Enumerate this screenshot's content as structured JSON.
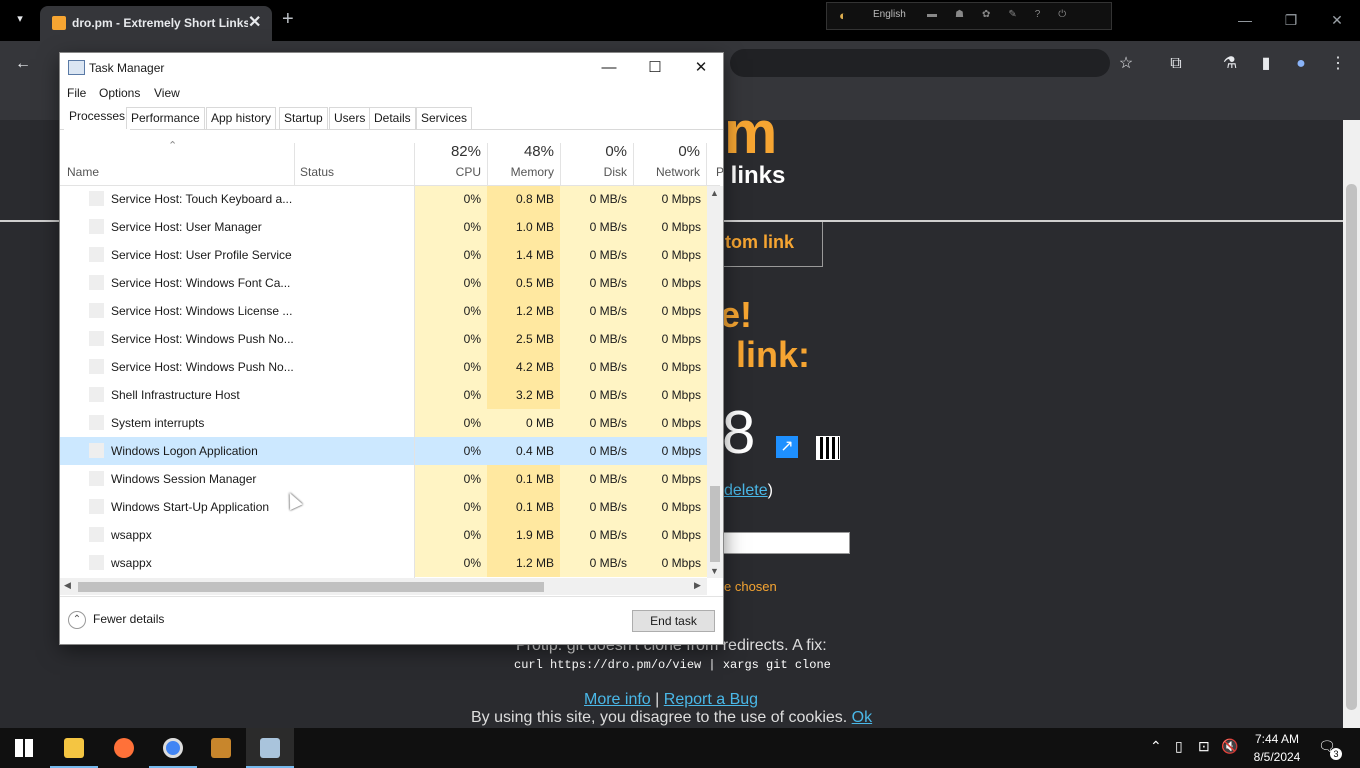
{
  "browser": {
    "tab_title": "dro.pm - Extremely Short Links",
    "lang": "English",
    "tab_close": "✕",
    "new_tab": "+"
  },
  "page": {
    "logo_partial": "m",
    "tagline_partial": "t links",
    "custom_btn_partial": "tom link",
    "heading1_partial": "e!",
    "heading2_partial": "link:",
    "short_code_partial": "8",
    "delete_link": "delete",
    "delete_close": ")",
    "chosen_partial": "e chosen",
    "protip": "Protip: git doesn't clone from redirects. A fix:",
    "protip_code": "curl https://dro.pm/o/view | xargs git clone",
    "more_info": "More info",
    "sep": "|",
    "report_bug": "Report a Bug",
    "cookie_text": "By using this site, you disagree to the use of cookies.",
    "cookie_ok": "Ok"
  },
  "task_manager": {
    "title": "Task Manager",
    "menu": [
      "File",
      "Options",
      "View"
    ],
    "tabs": [
      "Processes",
      "Performance",
      "App history",
      "Startup",
      "Users",
      "Details",
      "Services"
    ],
    "columns": {
      "name": "Name",
      "status": "Status",
      "cpu_pct": "82%",
      "cpu": "CPU",
      "mem_pct": "48%",
      "mem": "Memory",
      "disk_pct": "0%",
      "disk": "Disk",
      "net_pct": "0%",
      "net": "Network",
      "p": "P"
    },
    "rows": [
      {
        "name": "Service Host: Touch Keyboard a...",
        "cpu": "0%",
        "mem": "0.8 MB",
        "disk": "0 MB/s",
        "net": "0 Mbps"
      },
      {
        "name": "Service Host: User Manager",
        "cpu": "0%",
        "mem": "1.0 MB",
        "disk": "0 MB/s",
        "net": "0 Mbps"
      },
      {
        "name": "Service Host: User Profile Service",
        "cpu": "0%",
        "mem": "1.4 MB",
        "disk": "0 MB/s",
        "net": "0 Mbps"
      },
      {
        "name": "Service Host: Windows Font Ca...",
        "cpu": "0%",
        "mem": "0.5 MB",
        "disk": "0 MB/s",
        "net": "0 Mbps"
      },
      {
        "name": "Service Host: Windows License ...",
        "cpu": "0%",
        "mem": "1.2 MB",
        "disk": "0 MB/s",
        "net": "0 Mbps"
      },
      {
        "name": "Service Host: Windows Push No...",
        "cpu": "0%",
        "mem": "2.5 MB",
        "disk": "0 MB/s",
        "net": "0 Mbps"
      },
      {
        "name": "Service Host: Windows Push No...",
        "cpu": "0%",
        "mem": "4.2 MB",
        "disk": "0 MB/s",
        "net": "0 Mbps"
      },
      {
        "name": "Shell Infrastructure Host",
        "cpu": "0%",
        "mem": "3.2 MB",
        "disk": "0 MB/s",
        "net": "0 Mbps"
      },
      {
        "name": "System interrupts",
        "cpu": "0%",
        "mem": "0 MB",
        "disk": "0 MB/s",
        "net": "0 Mbps"
      },
      {
        "name": "Windows Logon Application",
        "cpu": "0%",
        "mem": "0.4 MB",
        "disk": "0 MB/s",
        "net": "0 Mbps"
      },
      {
        "name": "Windows Session Manager",
        "cpu": "0%",
        "mem": "0.1 MB",
        "disk": "0 MB/s",
        "net": "0 Mbps"
      },
      {
        "name": "Windows Start-Up Application",
        "cpu": "0%",
        "mem": "0.1 MB",
        "disk": "0 MB/s",
        "net": "0 Mbps"
      },
      {
        "name": "wsappx",
        "cpu": "0%",
        "mem": "1.9 MB",
        "disk": "0 MB/s",
        "net": "0 Mbps"
      },
      {
        "name": "wsappx",
        "cpu": "0%",
        "mem": "1.2 MB",
        "disk": "0 MB/s",
        "net": "0 Mbps"
      }
    ],
    "selected_row": "Windows Logon Application",
    "fewer_details": "Fewer details",
    "end_task": "End task"
  },
  "taskbar": {
    "time": "7:44 AM",
    "date": "8/5/2024",
    "notifications": "3"
  },
  "colors": {
    "accent": "#f6a532",
    "link": "#4ab8e8",
    "heat_light": "#fff4c4",
    "heat_mid": "#ffe8a0",
    "selection": "#cce8ff"
  }
}
